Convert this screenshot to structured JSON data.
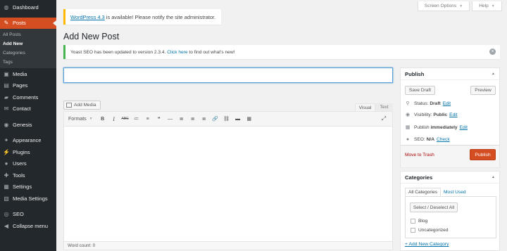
{
  "sidebar": {
    "items": [
      {
        "label": "Dashboard",
        "icon": "dashboard-icon",
        "glyph": "◍"
      },
      {
        "label": "Posts",
        "icon": "pushpin-icon",
        "glyph": "✎"
      },
      {
        "label": "Media",
        "icon": "media-icon",
        "glyph": "▣"
      },
      {
        "label": "Pages",
        "icon": "pages-icon",
        "glyph": "▤"
      },
      {
        "label": "Comments",
        "icon": "comments-icon",
        "glyph": "▰"
      },
      {
        "label": "Contact",
        "icon": "mail-icon",
        "glyph": "✉"
      },
      {
        "label": "Genesis",
        "icon": "genesis-icon",
        "glyph": "◉"
      },
      {
        "label": "Appearance",
        "icon": "brush-icon",
        "glyph": "✦"
      },
      {
        "label": "Plugins",
        "icon": "plugin-icon",
        "glyph": "⚡"
      },
      {
        "label": "Users",
        "icon": "users-icon",
        "glyph": "●"
      },
      {
        "label": "Tools",
        "icon": "wrench-icon",
        "glyph": "✚"
      },
      {
        "label": "Settings",
        "icon": "settings-icon",
        "glyph": "▦"
      },
      {
        "label": "Media Settings",
        "icon": "media-settings-icon",
        "glyph": "▧"
      },
      {
        "label": "SEO",
        "icon": "seo-icon",
        "glyph": "◎"
      },
      {
        "label": "Collapse menu",
        "icon": "collapse-icon",
        "glyph": "◀"
      }
    ],
    "posts_submenu": [
      "All Posts",
      "Add New",
      "Categories",
      "Tags"
    ]
  },
  "top": {
    "screen_options": "Screen Options",
    "help": "Help"
  },
  "notice": {
    "link": "WordPress 4.3",
    "text": " is available! Please notify the site administrator."
  },
  "page_title": "Add New Post",
  "yoast": {
    "text": "Yoast SEO has been updated to version 2.3.4. ",
    "link": "Click here",
    "text_after": " to find out what's new!"
  },
  "editor": {
    "add_media": "Add Media",
    "tab_visual": "Visual",
    "tab_text": "Text",
    "formats": "Formats",
    "toolbar": [
      "B",
      "I",
      "ABC",
      "≔",
      "≡",
      "❝",
      "—",
      "≣",
      "≣",
      "≣",
      "🔗",
      "⛓",
      "▬",
      "▦"
    ],
    "word_count": "Word count: 0"
  },
  "publish": {
    "title": "Publish",
    "save_draft": "Save Draft",
    "preview": "Preview",
    "status_label": "Status: ",
    "status_value": "Draft",
    "visibility_label": "Visibility: ",
    "visibility_value": "Public",
    "publish_label": "Publish ",
    "publish_value": "immediately",
    "seo_label": "SEO: ",
    "seo_value": "N/A",
    "edit": "Edit",
    "check": "Check",
    "trash": "Move to Trash",
    "publish_button": "Publish"
  },
  "categories": {
    "title": "Categories",
    "tab_all": "All Categories",
    "tab_most": "Most Used",
    "select_all": "Select / Deselect All",
    "items": [
      "Blog",
      "Uncategorized"
    ],
    "add_new": "+ Add New Category"
  },
  "colors": {
    "sidebar_bg": "#23282d",
    "accent": "#d54e21",
    "link": "#0073aa",
    "notice_warning": "#ffb900",
    "notice_success": "#46b450"
  }
}
